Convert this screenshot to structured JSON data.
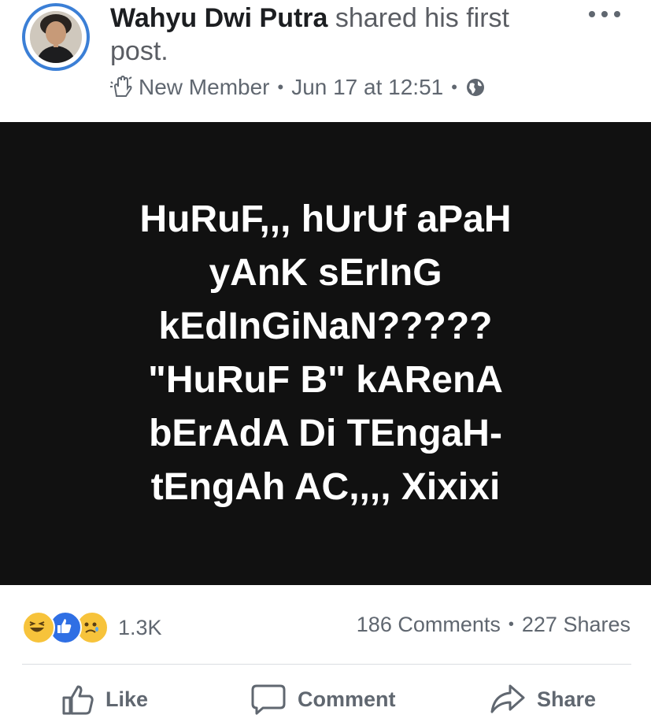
{
  "post": {
    "author": "Wahyu Dwi Putra",
    "action_text": " shared his first post.",
    "badge_label": "New Member",
    "timestamp": "Jun 17 at 12:51",
    "separator": "•",
    "image_text": "HuRuF,,, hUrUf aPaH\nyAnK sErInG\nkEdInGiNaN?????\n\"HuRuF B\" kARenA\nbErAdA Di TEngaH-\ntEngAh AC,,,, Xixixi"
  },
  "stats": {
    "reaction_count": "1.3K",
    "comments": "186 Comments",
    "shares": "227 Shares",
    "reactions": [
      "haha-icon",
      "like-icon",
      "sad-icon"
    ]
  },
  "actions": {
    "like": "Like",
    "comment": "Comment",
    "share": "Share"
  },
  "colors": {
    "accent": "#3b7fd6",
    "like_blue": "#2f6fe4",
    "reaction_yellow": "#f7c33b",
    "image_bg": "#111111",
    "muted": "#606770"
  }
}
